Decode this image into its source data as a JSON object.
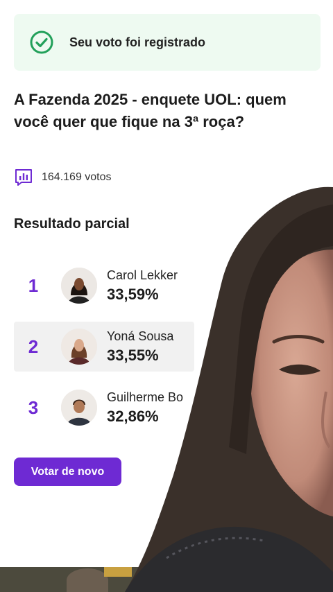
{
  "banner": {
    "message": "Seu voto foi registrado",
    "icon": "check-circle-icon",
    "accent": "#22a05a"
  },
  "poll": {
    "title": "A Fazenda 2025 - enquete UOL: quem você quer que fique na 3ª roça?"
  },
  "votes": {
    "icon": "bar-chart-icon",
    "count_text": "164.169 votos"
  },
  "results": {
    "title": "Resultado parcial",
    "items": [
      {
        "rank": "1",
        "name": "Carol Lekker",
        "percent": "33,59%"
      },
      {
        "rank": "2",
        "name": "Yoná Sousa",
        "percent": "33,55%"
      },
      {
        "rank": "3",
        "name": "Guilherme Bo",
        "percent": "32,86%"
      }
    ]
  },
  "actions": {
    "vote_again_label": "Votar de novo"
  },
  "colors": {
    "brand_purple": "#6e2ad3",
    "success_bg": "#eefaf1"
  }
}
